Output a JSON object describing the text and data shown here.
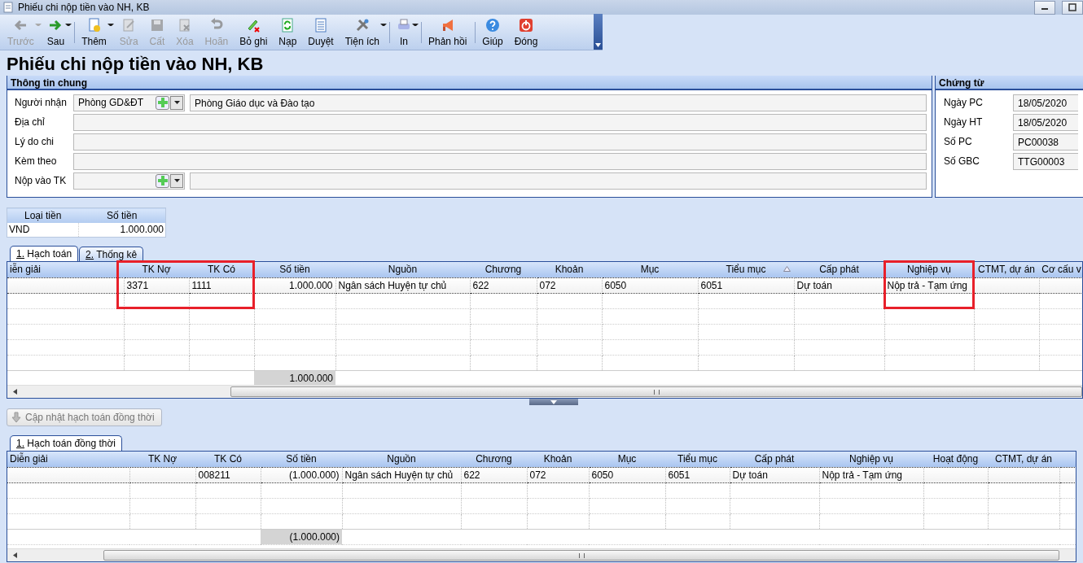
{
  "window": {
    "title": "Phiếu chi nộp tiền vào NH, KB"
  },
  "toolbar": [
    {
      "label": "Trước",
      "disabled": true,
      "dropdown": true,
      "separator_before": false
    },
    {
      "label": "Sau",
      "disabled": false,
      "dropdown": true,
      "separator_before": false
    },
    {
      "label": "Thêm",
      "disabled": false,
      "dropdown": true,
      "separator_before": true
    },
    {
      "label": "Sửa",
      "disabled": true,
      "dropdown": false,
      "separator_before": false
    },
    {
      "label": "Cất",
      "disabled": true,
      "dropdown": false,
      "separator_before": false
    },
    {
      "label": "Xóa",
      "disabled": true,
      "dropdown": false,
      "separator_before": false
    },
    {
      "label": "Hoãn",
      "disabled": true,
      "dropdown": false,
      "separator_before": false
    },
    {
      "label": "Bỏ ghi",
      "disabled": false,
      "dropdown": false,
      "separator_before": false
    },
    {
      "label": "Nạp",
      "disabled": false,
      "dropdown": false,
      "separator_before": false
    },
    {
      "label": "Duyệt",
      "disabled": false,
      "dropdown": false,
      "separator_before": false
    },
    {
      "label": "Tiện ích",
      "disabled": false,
      "dropdown": true,
      "separator_before": false
    },
    {
      "label": "In",
      "disabled": false,
      "dropdown": true,
      "separator_before": true
    },
    {
      "label": "Phản hồi",
      "disabled": false,
      "dropdown": false,
      "separator_before": true
    },
    {
      "label": "Giúp",
      "disabled": false,
      "dropdown": false,
      "separator_before": true
    },
    {
      "label": "Đóng",
      "disabled": false,
      "dropdown": false,
      "separator_before": false
    }
  ],
  "heading": "Phiếu chi nộp tiền vào NH, KB",
  "general": {
    "title": "Thông tin chung",
    "fields": [
      {
        "label": "Người nhận",
        "kind": "lookup",
        "value": "Phòng GD&ĐT",
        "name": "Phòng Giáo dục và Đào tạo"
      },
      {
        "label": "Địa chỉ",
        "kind": "text"
      },
      {
        "label": "Lý do chi",
        "kind": "text"
      },
      {
        "label": "Kèm theo",
        "kind": "text"
      },
      {
        "label": "Nộp vào TK",
        "kind": "lookup"
      }
    ]
  },
  "voucher": {
    "title": "Chứng từ",
    "fields": [
      {
        "label": "Ngày PC",
        "value": "18/05/2020"
      },
      {
        "label": "Ngày HT",
        "value": "18/05/2020"
      },
      {
        "label": "Số PC",
        "value": "PC00038"
      },
      {
        "label": "Số GBC",
        "value": "TTG00003"
      }
    ]
  },
  "currency": {
    "columns": [
      "Loại tiền",
      "Số tiền"
    ],
    "rows": [
      [
        "VND",
        "1.000.000"
      ]
    ]
  },
  "tabs": [
    {
      "label": "1. Hạch toán",
      "selected": true
    },
    {
      "label": "2. Thống kê",
      "selected": false
    }
  ],
  "entries": {
    "columns": [
      {
        "label": "iễn giải",
        "kind": "text",
        "highlighted": false,
        "sorted": false
      },
      {
        "label": "TK Nợ",
        "kind": "text",
        "highlighted": true,
        "sorted": false
      },
      {
        "label": "TK Có",
        "kind": "text",
        "highlighted": true,
        "sorted": false
      },
      {
        "label": "Số tiền",
        "kind": "amount",
        "highlighted": false,
        "sorted": false,
        "total": "1.000.000"
      },
      {
        "label": "Nguồn",
        "kind": "text",
        "highlighted": false,
        "sorted": false
      },
      {
        "label": "Chương",
        "kind": "text",
        "highlighted": false,
        "sorted": false
      },
      {
        "label": "Khoản",
        "kind": "text",
        "highlighted": false,
        "sorted": false
      },
      {
        "label": "Mục",
        "kind": "text",
        "highlighted": false,
        "sorted": false
      },
      {
        "label": "Tiểu mục",
        "kind": "text",
        "highlighted": false,
        "sorted": true
      },
      {
        "label": "Cấp phát",
        "kind": "text",
        "highlighted": false,
        "sorted": false
      },
      {
        "label": "Nghiệp vụ",
        "kind": "text",
        "highlighted": true,
        "sorted": false
      },
      {
        "label": "CTMT, dự án",
        "kind": "text",
        "highlighted": false,
        "sorted": false
      },
      {
        "label": "Cơ cấu v",
        "kind": "text",
        "highlighted": false,
        "sorted": false
      }
    ],
    "rows": [
      [
        null,
        "3371",
        "1111",
        "1.000.000",
        "Ngân sách Huyện tự chủ",
        "622",
        "072",
        "6050",
        "6051",
        "Dự toán",
        "Nộp trả - Tạm ứng",
        null,
        null
      ]
    ]
  },
  "sync_button": {
    "label": "Cập nhật hạch toán đồng thời",
    "disabled": true
  },
  "sync_tabs": [
    {
      "label": "1. Hạch toán đồng thời",
      "selected": true
    }
  ],
  "sync_entries": {
    "columns": [
      {
        "label": "Diễn giải",
        "kind": "text",
        "highlighted": false,
        "sorted": false
      },
      {
        "label": "TK Nợ",
        "kind": "text",
        "highlighted": false,
        "sorted": false
      },
      {
        "label": "TK Có",
        "kind": "text",
        "highlighted": false,
        "sorted": false
      },
      {
        "label": "Số tiền",
        "kind": "amount",
        "highlighted": false,
        "sorted": false,
        "total": "(1.000.000)"
      },
      {
        "label": "Nguồn",
        "kind": "text",
        "highlighted": false,
        "sorted": false
      },
      {
        "label": "Chương",
        "kind": "text",
        "highlighted": false,
        "sorted": false
      },
      {
        "label": "Khoản",
        "kind": "text",
        "highlighted": false,
        "sorted": false
      },
      {
        "label": "Mục",
        "kind": "text",
        "highlighted": false,
        "sorted": false
      },
      {
        "label": "Tiểu mục",
        "kind": "text",
        "highlighted": false,
        "sorted": false
      },
      {
        "label": "Cấp phát",
        "kind": "text",
        "highlighted": false,
        "sorted": false
      },
      {
        "label": "Nghiệp vụ",
        "kind": "text",
        "highlighted": false,
        "sorted": false
      },
      {
        "label": "Hoạt động",
        "kind": "text",
        "highlighted": false,
        "sorted": false
      },
      {
        "label": "CTMT, dự án",
        "kind": "text",
        "highlighted": false,
        "sorted": false
      }
    ],
    "rows": [
      [
        null,
        null,
        "008211",
        "(1.000.000)",
        "Ngân sách Huyện tự chủ",
        "622",
        "072",
        "6050",
        "6051",
        "Dự toán",
        "Nộp trả - Tạm ứng",
        null,
        null
      ]
    ]
  }
}
